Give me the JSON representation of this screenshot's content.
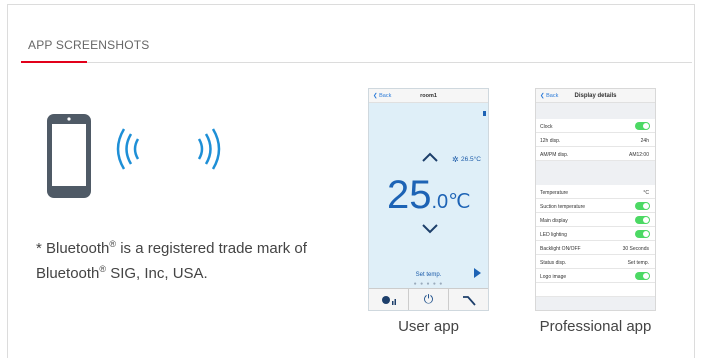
{
  "section": {
    "title": "APP SCREENSHOTS"
  },
  "note": {
    "prefix": "* Bluetooth",
    "reg1": "®",
    "middle": " is a registered trade mark of Bluetooth",
    "reg2": "®",
    "suffix": " SIG, Inc, USA."
  },
  "user_app": {
    "back": "❮ Back",
    "room": "room1",
    "sub_temp": "26.5°C",
    "temp_main": "25",
    "temp_small": ".0℃",
    "label": "Set temp.",
    "dots": "● ● ● ● ●",
    "power_icon": "⏻",
    "caption": "User app"
  },
  "pro_app": {
    "back": "❮ Back",
    "title": "Display details",
    "rows": {
      "clock": "Clock",
      "h12": "12h disp.",
      "h12_val": "24h",
      "ampm": "AM/PM disp.",
      "ampm_val": "AM12:00",
      "temperature": "Temperature",
      "temperature_val": "°C",
      "suction": "Suction temperature",
      "main_display": "Main display",
      "led": "LED lighting",
      "backlight": "Backlight ON/OFF",
      "backlight_val": "30 Seconds",
      "status": "Status disp.",
      "status_val": "Set temp.",
      "logo": "Logo image"
    },
    "caption": "Professional app"
  },
  "colors": {
    "accent_red": "#e2001a",
    "brand_blue": "#1d63b5",
    "toggle_green": "#4cd964"
  }
}
